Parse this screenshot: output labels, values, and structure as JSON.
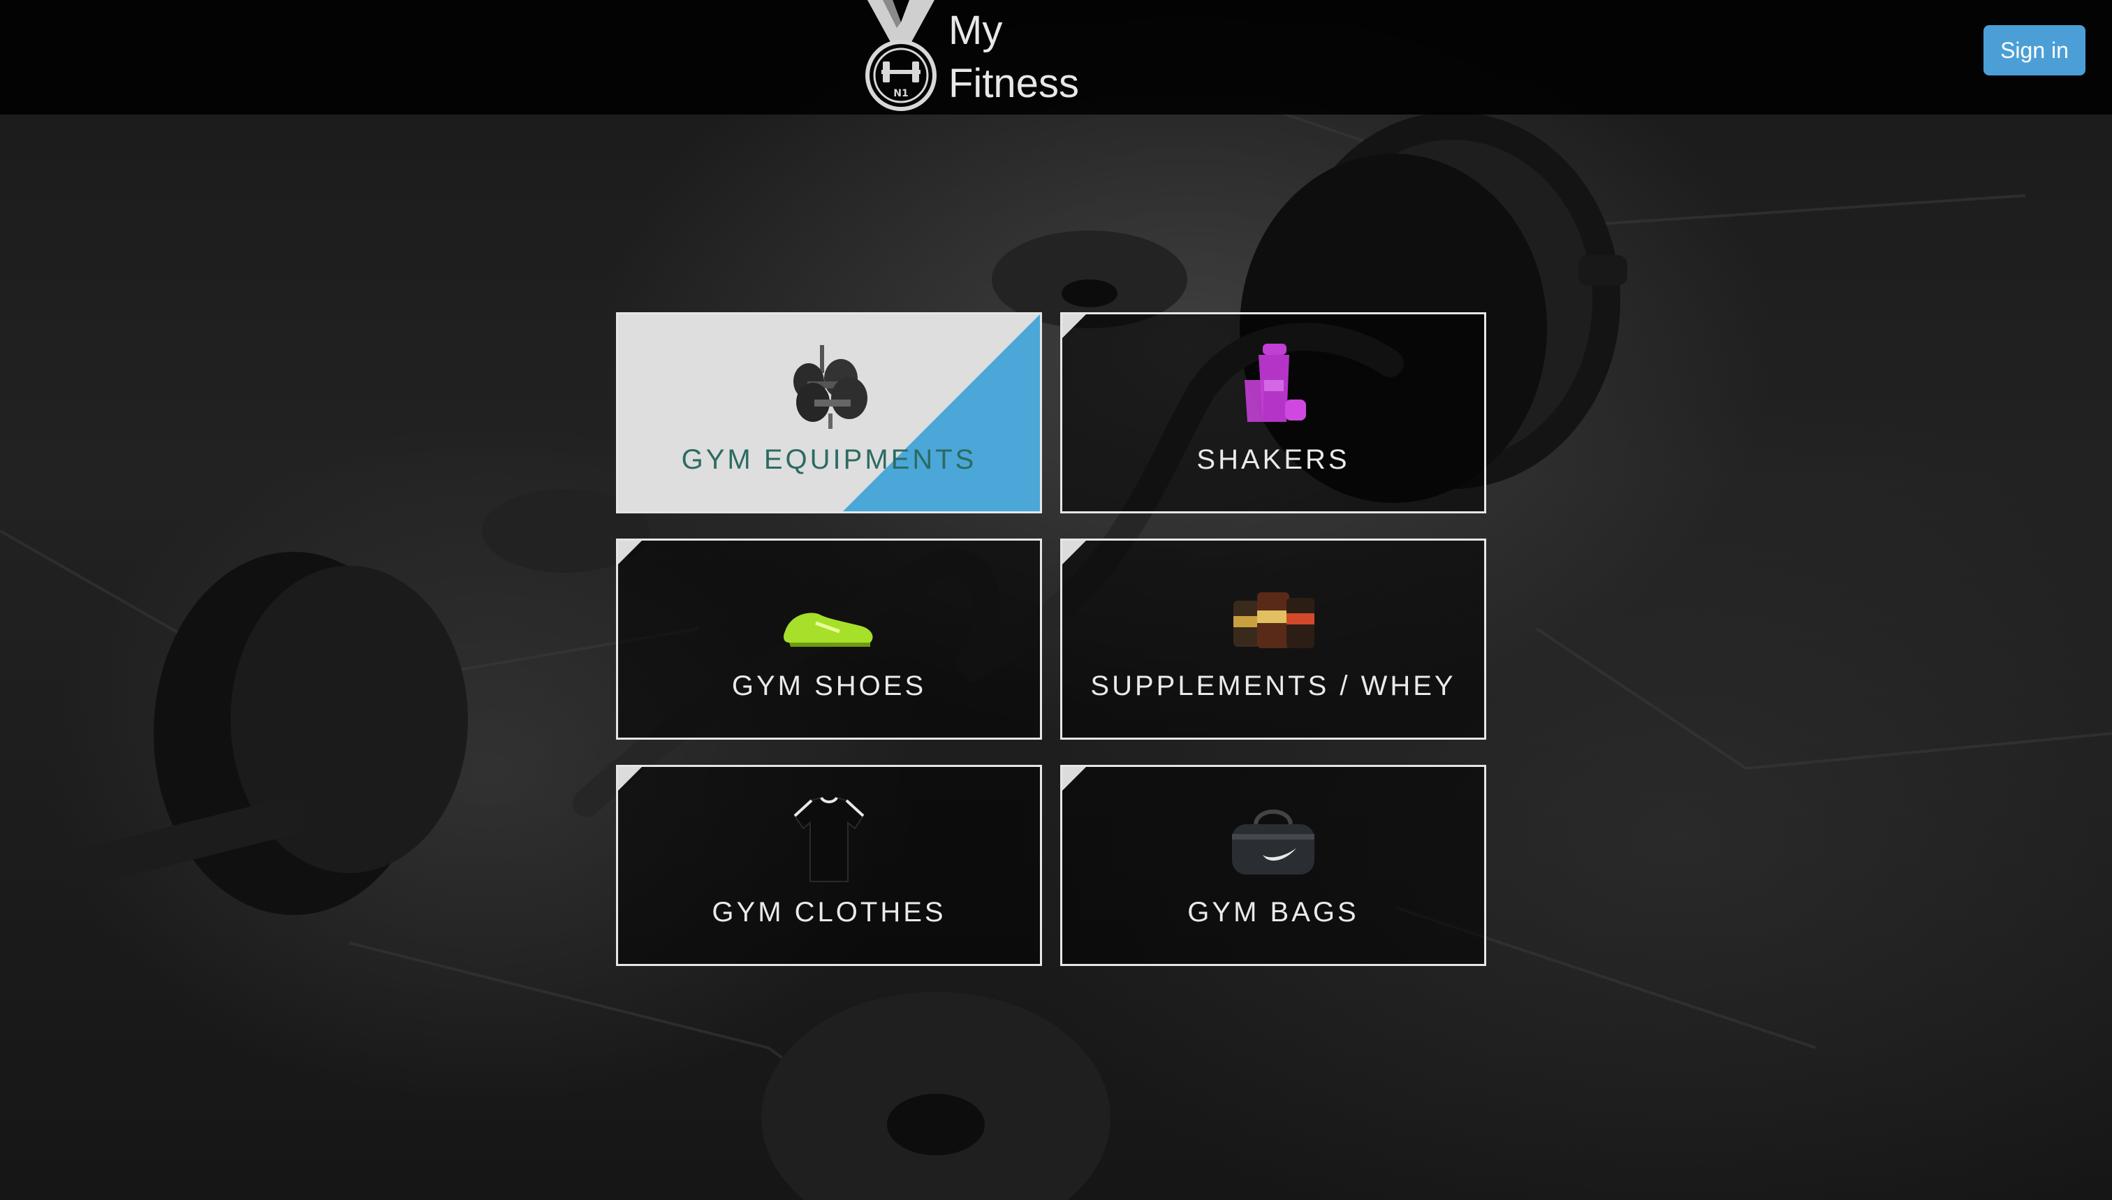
{
  "header": {
    "brand_line1": "My",
    "brand_line2": "Fitness",
    "signin_label": "Sign in",
    "logo_icon": "medal-dumbbell-logo-icon"
  },
  "categories": [
    {
      "label": "GYM EQUIPMENTS",
      "icon": "dumbbell-icon",
      "active": true
    },
    {
      "label": "SHAKERS",
      "icon": "shaker-icon",
      "active": false
    },
    {
      "label": "GYM SHOES",
      "icon": "shoe-icon",
      "active": false
    },
    {
      "label": "SUPPLEMENTS / WHEY",
      "icon": "supplement-icon",
      "active": false
    },
    {
      "label": "GYM CLOTHES",
      "icon": "tshirt-icon",
      "active": false
    },
    {
      "label": "GYM BAGS",
      "icon": "gym-bag-icon",
      "active": false
    }
  ],
  "colors": {
    "accent": "#4aa7d8",
    "signin": "#4c9fd6",
    "active_label": "#2c6b62",
    "shaker": "#c23fd4",
    "shoe": "#a6e02a"
  }
}
